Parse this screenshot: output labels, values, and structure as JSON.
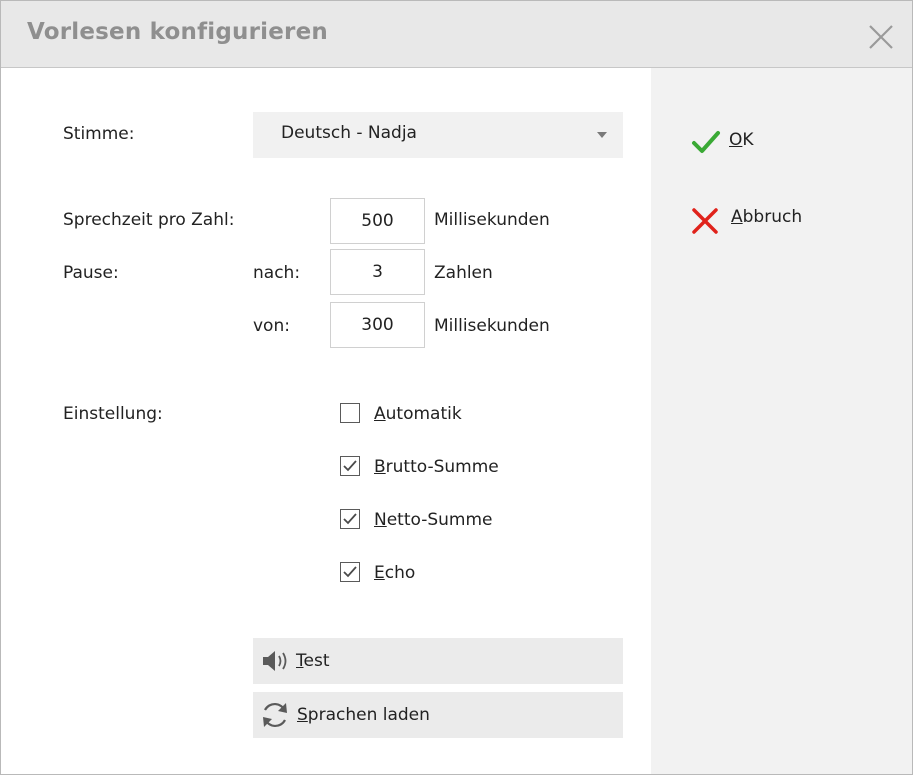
{
  "window": {
    "title": "Vorlesen konfigurieren"
  },
  "voice": {
    "label": "Stimme:",
    "selected": "Deutsch - Nadja"
  },
  "timing": {
    "speech_label": "Sprechzeit pro Zahl:",
    "speech_value": "500",
    "speech_unit": "Millisekunden",
    "pause_label": "Pause:",
    "after_label": "nach:",
    "after_value": "3",
    "after_unit": "Zahlen",
    "from_label": "von:",
    "from_value": "300",
    "from_unit": "Millisekunden"
  },
  "settings": {
    "label": "Einstellung:",
    "options": [
      {
        "key": "A",
        "rest": "utomatik",
        "checked": false
      },
      {
        "key": "B",
        "rest": "rutto-Summe",
        "checked": true
      },
      {
        "key": "N",
        "rest": "etto-Summe",
        "checked": true
      },
      {
        "key": "E",
        "rest": "cho",
        "checked": true
      }
    ]
  },
  "actions": {
    "test_key": "T",
    "test_rest": "est",
    "reload_key": "S",
    "reload_rest": "prachen laden"
  },
  "side": {
    "ok_key": "O",
    "ok_rest": "K",
    "cancel_key": "A",
    "cancel_rest": "bbruch"
  },
  "colors": {
    "ok": "#3aa935",
    "cancel": "#e0221b",
    "title": "#8f8f8f"
  }
}
